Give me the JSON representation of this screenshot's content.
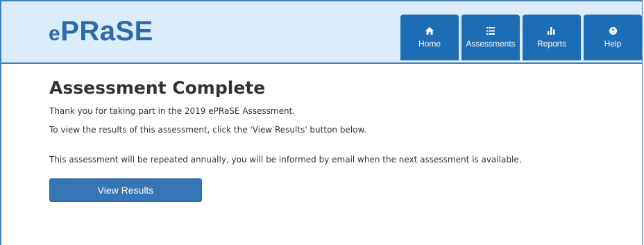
{
  "header": {
    "logo_text": "PRaSE",
    "logo_prefix": "e",
    "nav": [
      {
        "label": "Home",
        "icon": "home-icon"
      },
      {
        "label": "Assessments",
        "icon": "list-icon"
      },
      {
        "label": "Reports",
        "icon": "bar-chart-icon"
      },
      {
        "label": "Help",
        "icon": "help-icon"
      }
    ]
  },
  "main": {
    "title": "Assessment Complete",
    "thanks": "Thank you for taking part in the 2019 ePRaSE Assessment.",
    "instructions": "To view the results of this assessment, click the 'View Results' button below.",
    "notice": "This assessment will be repeated annually, you will be informed by email when the next assessment is available.",
    "view_results_label": "View Results"
  },
  "colors": {
    "header_bg": "#dcecfb",
    "nav_button": "#1d6db5",
    "primary_button": "#3676b4",
    "logo": "#2a6aad"
  }
}
